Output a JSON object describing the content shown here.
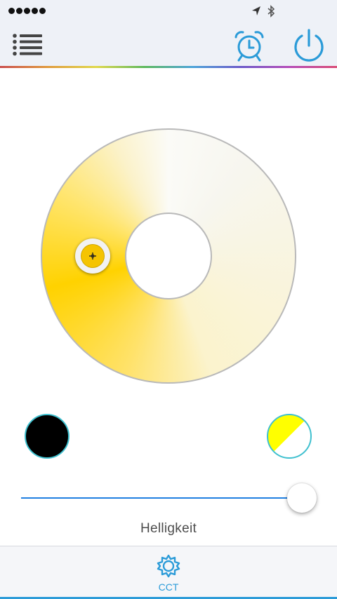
{
  "status_bar": {
    "signal_dots": 5,
    "icons": [
      "location-arrow-icon",
      "bluetooth-icon"
    ]
  },
  "nav_bar": {
    "menu_icon": "list-icon",
    "alarm_icon": "alarm-clock-icon",
    "power_icon": "power-icon",
    "accent_color": "#2b9bd8"
  },
  "color_wheel": {
    "warm_color": "#ffd200",
    "cool_color": "#fbfbf7",
    "selected_color": "#f5c400"
  },
  "swatches": {
    "left_color": "#000000",
    "right_colors": [
      "#ffff00",
      "#ffffff"
    ],
    "border_color": "#3fc0cf"
  },
  "brightness": {
    "label": "Helligkeit",
    "value_percent": 100
  },
  "tab_bar": {
    "tabs": [
      {
        "label": "CCT",
        "icon": "sun-gear-icon",
        "active": true
      }
    ]
  }
}
